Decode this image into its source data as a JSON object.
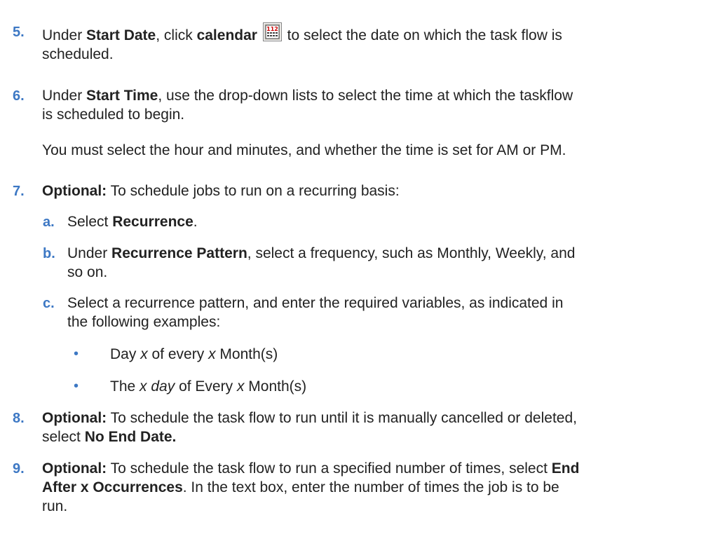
{
  "steps": [
    {
      "number": "5.",
      "pre": "Under ",
      "b1": "Start Date",
      "mid": ", click ",
      "b2": "calendar",
      "post": " to select the date on which the task flow is",
      "line2": "scheduled.",
      "icon": "calendar-icon"
    },
    {
      "number": "6.",
      "pre": "Under ",
      "b1": "Start Time",
      "post": ", use the drop-down lists to select the time at which the taskflow",
      "line2": "is scheduled to begin.",
      "note": "You must select the hour and minutes, and whether the time is set for AM or PM."
    },
    {
      "number": "7.",
      "b1": "Optional:",
      "post": " To schedule jobs to run on a recurring basis:",
      "substeps": [
        {
          "letter": "a.",
          "pre": "Select ",
          "b1": "Recurrence",
          "post": "."
        },
        {
          "letter": "b.",
          "pre": "Under ",
          "b1": "Recurrence Pattern",
          "post": ", select a frequency, such as Monthly, Weekly, and",
          "line2": "so on."
        },
        {
          "letter": "c.",
          "line1": "Select a recurrence pattern, and enter the required variables, as indicated in",
          "line2": "the following examples:"
        }
      ],
      "bullets": [
        {
          "mark": "•",
          "p1": "Day ",
          "i1": "x",
          "p2": " of every ",
          "i2": "x",
          "p3": " Month(s)"
        },
        {
          "mark": "•",
          "p1": "The ",
          "i1": "x day",
          "p2": " of Every ",
          "i2": "x",
          "p3": " Month(s)"
        }
      ]
    },
    {
      "number": "8.",
      "b1": "Optional:",
      "post": " To schedule the task flow to run until it is manually cancelled or deleted,",
      "line2_pre": "select ",
      "line2_b": "No End Date."
    },
    {
      "number": "9.",
      "b1": "Optional:",
      "post": " To schedule the task flow to run a specified number of times, select ",
      "b2": "End",
      "line2_b": "After x Occurrences",
      "line2_post": ". In the text box, enter the number of times the job is to be",
      "line3": "run."
    }
  ],
  "colors": {
    "numbering": "#3d78c4",
    "text": "#222222"
  }
}
